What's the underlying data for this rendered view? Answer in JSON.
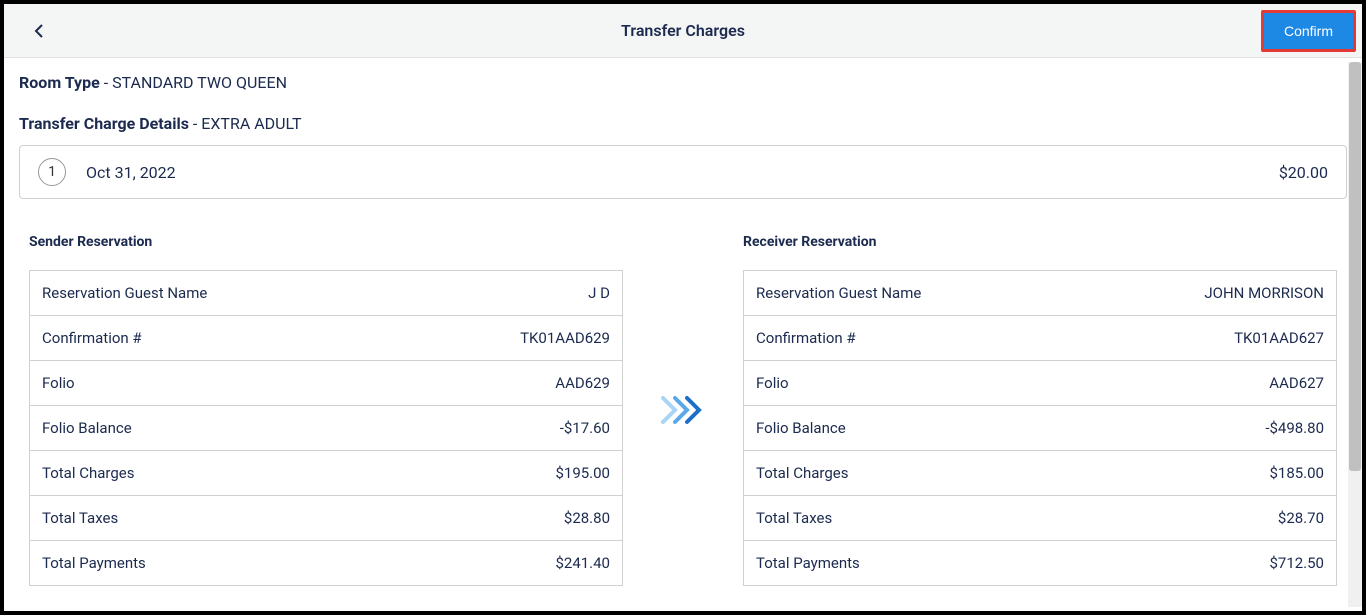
{
  "header": {
    "title": "Transfer Charges",
    "confirm_label": "Confirm"
  },
  "room_type": {
    "label": "Room Type",
    "value": "STANDARD TWO QUEEN"
  },
  "transfer_detail": {
    "label": "Transfer Charge Details",
    "value": "EXTRA ADULT"
  },
  "charge_item": {
    "number": "1",
    "date": "Oct 31, 2022",
    "amount": "$20.00"
  },
  "sender": {
    "title": "Sender Reservation",
    "rows": [
      {
        "label": "Reservation Guest Name",
        "value": "J D"
      },
      {
        "label": "Confirmation #",
        "value": "TK01AAD629"
      },
      {
        "label": "Folio",
        "value": "AAD629"
      },
      {
        "label": "Folio Balance",
        "value": "-$17.60"
      },
      {
        "label": "Total Charges",
        "value": "$195.00"
      },
      {
        "label": "Total Taxes",
        "value": "$28.80"
      },
      {
        "label": "Total Payments",
        "value": "$241.40"
      }
    ]
  },
  "receiver": {
    "title": "Receiver Reservation",
    "rows": [
      {
        "label": "Reservation Guest Name",
        "value": "JOHN MORRISON"
      },
      {
        "label": "Confirmation #",
        "value": "TK01AAD627"
      },
      {
        "label": "Folio",
        "value": "AAD627"
      },
      {
        "label": "Folio Balance",
        "value": "-$498.80"
      },
      {
        "label": "Total Charges",
        "value": "$185.00"
      },
      {
        "label": "Total Taxes",
        "value": "$28.70"
      },
      {
        "label": "Total Payments",
        "value": "$712.50"
      }
    ]
  }
}
